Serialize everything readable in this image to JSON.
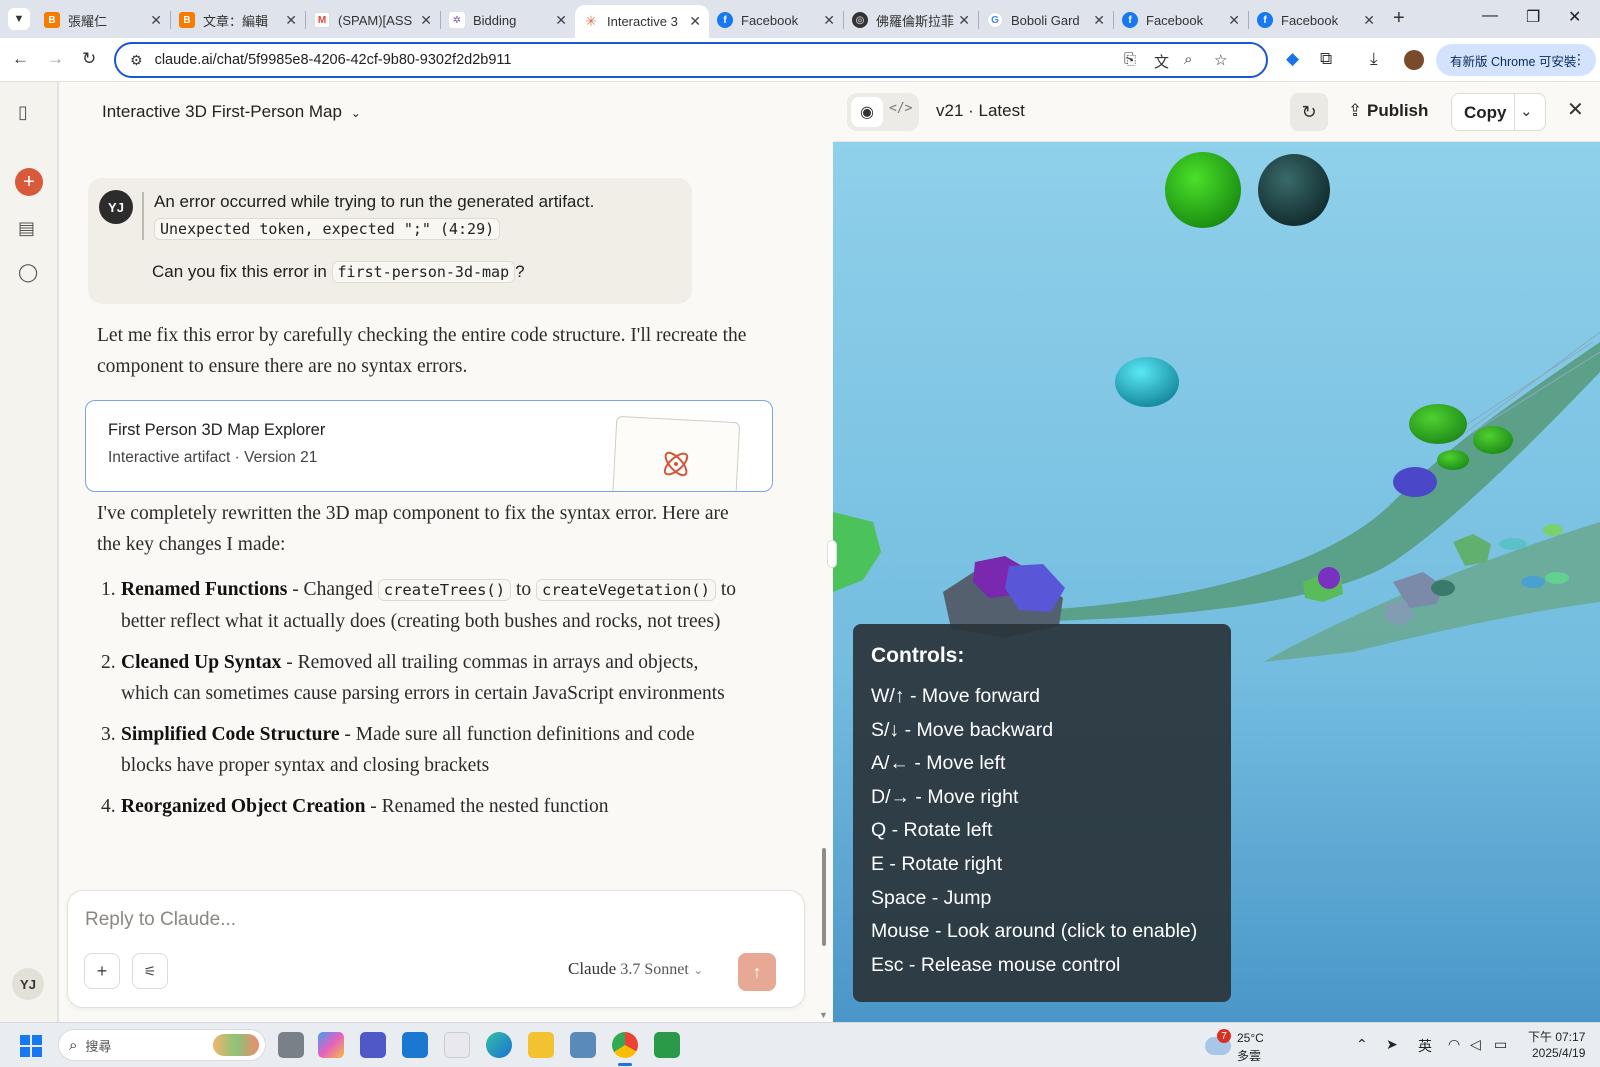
{
  "browser": {
    "tabs": [
      {
        "title": "張耀仁",
        "favicon": "blogger",
        "color": "#f57c00"
      },
      {
        "title": "文章：編輯",
        "favicon": "blogger",
        "color": "#f57c00"
      },
      {
        "title": "(SPAM)[ASS",
        "favicon": "gmail",
        "color": "#ea4335"
      },
      {
        "title": "Bidding",
        "favicon": "app",
        "color": "#7b5ea7"
      },
      {
        "title": "Interactive 3",
        "favicon": "claude",
        "color": "#d97757",
        "active": true
      },
      {
        "title": "Facebook",
        "favicon": "facebook",
        "color": "#1877f2"
      },
      {
        "title": "佛羅倫斯拉菲",
        "favicon": "app",
        "color": "#333333"
      },
      {
        "title": "Boboli Gard",
        "favicon": "google",
        "color": "#4285f4"
      },
      {
        "title": "Facebook",
        "favicon": "facebook",
        "color": "#1877f2"
      },
      {
        "title": "Facebook",
        "favicon": "facebook",
        "color": "#1877f2"
      }
    ],
    "url": "claude.ai/chat/5f9985e8-4206-42cf-9b80-9302f2d2b911",
    "update_label": "有新版 Chrome 可安裝"
  },
  "sidebar": {
    "user_initials": "YJ"
  },
  "chat": {
    "title": "Interactive 3D First-Person Map",
    "user_message": {
      "initials": "YJ",
      "error_text": "An error occurred while trying to run the generated artifact.",
      "error_code": "Unexpected token, expected \";\" (4:29)",
      "ask_prefix": "Can you fix this error in ",
      "ask_code": "first-person-3d-map",
      "ask_suffix": "?"
    },
    "reply_intro": "Let me fix this error by carefully checking the entire code structure. I'll recreate the component to ensure there are no syntax errors.",
    "artifact": {
      "title": "First Person 3D Map Explorer",
      "subtitle": "Interactive artifact · Version 21"
    },
    "reply_followup": "I've completely rewritten the 3D map component to fix the syntax error. Here are the key changes I made:",
    "changes": [
      {
        "num": "1.",
        "title": "Renamed Functions",
        "text_a": " - Changed ",
        "code_a": "createTrees()",
        "text_b": " to ",
        "code_b": "createVegetation()",
        "text_c": " to better reflect what it actually does (creating both bushes and rocks, not trees)"
      },
      {
        "num": "2.",
        "title": "Cleaned Up Syntax",
        "text_a": " - Removed all trailing commas in arrays and objects, which can sometimes cause parsing errors in certain JavaScript environments"
      },
      {
        "num": "3.",
        "title": "Simplified Code Structure",
        "text_a": " - Made sure all function definitions and code blocks have proper syntax and closing brackets"
      },
      {
        "num": "4.",
        "title": "Reorganized Object Creation",
        "text_a": " - Renamed the nested function"
      }
    ],
    "reply_placeholder": "Reply to Claude...",
    "model": {
      "name": "Claude",
      "version": "3.7 Sonnet"
    }
  },
  "artifact_panel": {
    "version_label": "v21 · Latest",
    "publish_label": "Publish",
    "copy_label": "Copy",
    "controls": {
      "title": "Controls:",
      "lines": [
        "W/↑ - Move forward",
        "S/↓ - Move backward",
        "A/← - Move left",
        "D/→ - Move right",
        "Q - Rotate left",
        "E - Rotate right",
        "Space - Jump",
        "Mouse - Look around (click to enable)",
        "Esc - Release mouse control"
      ]
    }
  },
  "taskbar": {
    "search_placeholder": "搜尋",
    "weather": {
      "badge": "7",
      "temp": "25°C",
      "desc": "多雲"
    },
    "ime": "英",
    "time": "下午 07:17",
    "date": "2025/4/19"
  },
  "icons": {
    "tab_list": "chevron-down-icon",
    "sidebar_toggle": "sidebar-icon",
    "new_chat": "plus-icon",
    "projects": "stack-icon",
    "chats": "chat-icon",
    "artifact_thumb": "atom-icon",
    "preview": "eye-icon",
    "code": "code-icon",
    "refresh": "refresh-icon",
    "publish": "share-icon",
    "close": "close-icon"
  }
}
